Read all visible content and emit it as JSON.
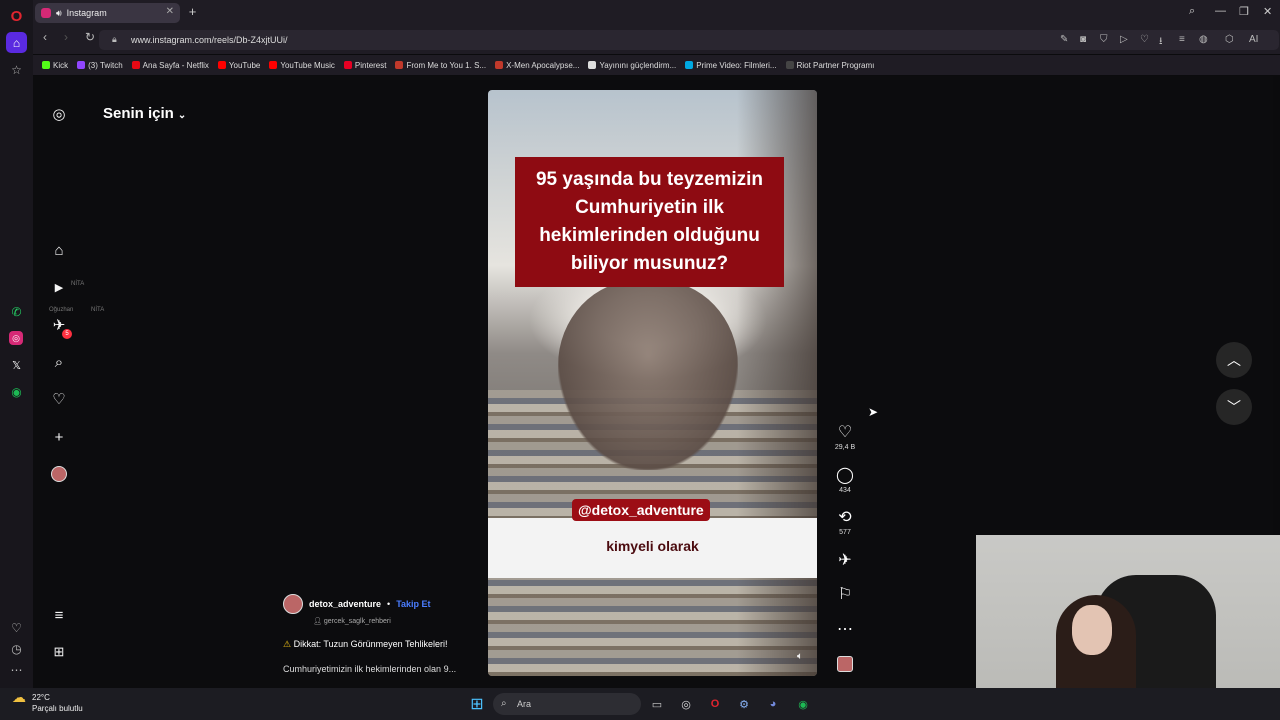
{
  "browser": {
    "tab_title": "Instagram",
    "url": "www.instagram.com/reels/Db-Z4xjtUUi/",
    "bookmarks": [
      {
        "label": "Kick",
        "color": "#53fc18"
      },
      {
        "label": "(3) Twitch",
        "color": "#9146ff"
      },
      {
        "label": "Ana Sayfa - Netflix",
        "color": "#e50914"
      },
      {
        "label": "YouTube",
        "color": "#ff0000"
      },
      {
        "label": "YouTube Music",
        "color": "#ff0000"
      },
      {
        "label": "Pinterest",
        "color": "#e60023"
      },
      {
        "label": "From Me to You 1. S...",
        "color": "#c0392b"
      },
      {
        "label": "X-Men Apocalypse...",
        "color": "#c0392b"
      },
      {
        "label": "Yayınını güçlendirm...",
        "color": "#dddddd"
      },
      {
        "label": "Prime Video: Filmleri...",
        "color": "#00a8e1"
      },
      {
        "label": "Riot Partner Programı",
        "color": "#444444"
      }
    ],
    "ai_label": "AI"
  },
  "instagram": {
    "feed_title": "Senin için",
    "notification_count": "5",
    "reel": {
      "headline": "95 yaşında bu teyzemizin Cumhuriyetin ilk hekimlerinden olduğunu biliyor musunuz?",
      "handle_tag": "@detox_adventure",
      "subtitle": "kimyeli olarak"
    },
    "actions": {
      "likes": "29,4 B",
      "comments": "434",
      "reposts": "577"
    },
    "post": {
      "username": "detox_adventure",
      "separator": "•",
      "follow": "Takip Et",
      "audio": "gercek_saglk_rehberi",
      "warning": "Dikkat: Tuzun Görünmeyen Tehlikeleri!",
      "caption": "Cumhuriyetimizin ilk hekimlerinden olan 9..."
    },
    "ghost_labels": [
      "NİTA",
      "Oğuzhan",
      "NİTA"
    ]
  },
  "taskbar": {
    "temperature": "22°C",
    "weather_desc": "Parçalı bulutlu",
    "search_placeholder": "Ara"
  }
}
